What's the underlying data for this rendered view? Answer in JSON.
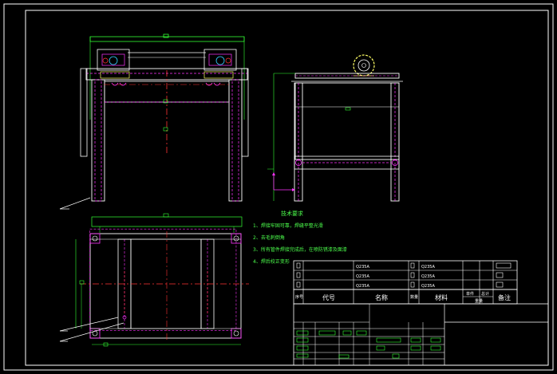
{
  "colors": {
    "background": "#000000",
    "frame": "#ffffff",
    "outline": "#ffffff",
    "hidden": "#ff33ff",
    "center": "#ff3333",
    "dimension": "#33ff33",
    "note_text": "#4cff4c",
    "detail": "#ffff66",
    "accent": "#33ccff"
  },
  "tech_notes": {
    "title": "技术要求",
    "items": [
      "1、焊接牢固可靠，焊缝平整光滑",
      "2、去毛刺倒角",
      "3、所有管件焊接完成后，在喷防锈漆及面漆",
      "4、焊后校正变形"
    ]
  },
  "title_block": {
    "parts_rows": [
      {
        "code": "Q235A",
        "material": "Q235A"
      },
      {
        "code": "Q235A",
        "material": "Q235A"
      },
      {
        "code": "Q235A",
        "material": "Q235A"
      }
    ],
    "header": {
      "seq": "序号",
      "code": "代号",
      "name": "名称",
      "qty": "数量",
      "material": "材料",
      "weight_single": "单件",
      "weight_total": "总计",
      "weight": "重量",
      "remark": "备注"
    }
  }
}
